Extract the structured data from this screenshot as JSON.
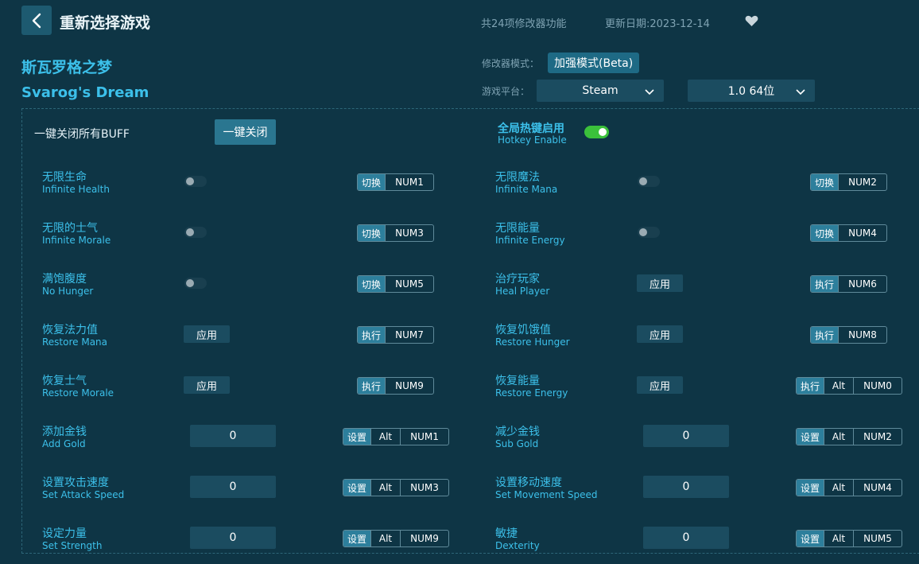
{
  "header": {
    "title": "重新选择游戏",
    "feature_count": "共24项修改器功能",
    "update_date": "更新日期:2023-12-14"
  },
  "game": {
    "name_cn": "斯瓦罗格之梦",
    "name_en": "Svarog's Dream"
  },
  "mode": {
    "label": "修改器模式：",
    "value": "加强模式(Beta)"
  },
  "platform": {
    "label": "游戏平台：",
    "value": "Steam",
    "version": "1.0 64位"
  },
  "close_all": {
    "label": "一键关闭所有BUFF",
    "button": "一键关闭"
  },
  "hotkey": {
    "label_cn": "全局热键启用",
    "label_en": "Hotkey Enable",
    "enabled": true
  },
  "colors": {
    "background": "#0e3545",
    "accent": "#3cc0ea",
    "toggle_on": "#3bc13b"
  },
  "features": [
    {
      "cn": "无限生命",
      "en": "Infinite Health",
      "control": "toggle",
      "keys": [
        "切换",
        "NUM1"
      ]
    },
    {
      "cn": "无限魔法",
      "en": "Infinite Mana",
      "control": "toggle",
      "keys": [
        "切换",
        "NUM2"
      ]
    },
    {
      "cn": "无限的士气",
      "en": "Infinite Morale",
      "control": "toggle",
      "keys": [
        "切换",
        "NUM3"
      ]
    },
    {
      "cn": "无限能量",
      "en": "Infinite Energy",
      "control": "toggle",
      "keys": [
        "切换",
        "NUM4"
      ]
    },
    {
      "cn": "满饱腹度",
      "en": "No Hunger",
      "control": "toggle",
      "keys": [
        "切换",
        "NUM5"
      ]
    },
    {
      "cn": "治疗玩家",
      "en": "Heal Player",
      "control": "apply",
      "control_text": "应用",
      "keys": [
        "执行",
        "NUM6"
      ]
    },
    {
      "cn": "恢复法力值",
      "en": "Restore Mana",
      "control": "apply",
      "control_text": "应用",
      "keys": [
        "执行",
        "NUM7"
      ]
    },
    {
      "cn": "恢复饥饿值",
      "en": "Restore Hunger",
      "control": "apply",
      "control_text": "应用",
      "keys": [
        "执行",
        "NUM8"
      ]
    },
    {
      "cn": "恢复士气",
      "en": "Restore Morale",
      "control": "apply",
      "control_text": "应用",
      "keys": [
        "执行",
        "NUM9"
      ]
    },
    {
      "cn": "恢复能量",
      "en": "Restore Energy",
      "control": "apply",
      "control_text": "应用",
      "keys": [
        "执行",
        "Alt",
        "NUM0"
      ]
    },
    {
      "cn": "添加金钱",
      "en": "Add Gold",
      "control": "input",
      "control_text": "0",
      "keys": [
        "设置",
        "Alt",
        "NUM1"
      ]
    },
    {
      "cn": "减少金钱",
      "en": "Sub Gold",
      "control": "input",
      "control_text": "0",
      "keys": [
        "设置",
        "Alt",
        "NUM2"
      ]
    },
    {
      "cn": "设置攻击速度",
      "en": "Set Attack Speed",
      "control": "input",
      "control_text": "0",
      "keys": [
        "设置",
        "Alt",
        "NUM3"
      ]
    },
    {
      "cn": "设置移动速度",
      "en": "Set Movement Speed",
      "control": "input",
      "control_text": "0",
      "keys": [
        "设置",
        "Alt",
        "NUM4"
      ]
    },
    {
      "cn": "设定力量",
      "en": "Set Strength",
      "control": "input",
      "control_text": "0",
      "keys": [
        "设置",
        "Alt",
        "NUM9"
      ]
    },
    {
      "cn": "敏捷",
      "en": "Dexterity",
      "control": "input",
      "control_text": "0",
      "keys": [
        "设置",
        "Alt",
        "NUM5"
      ]
    }
  ]
}
